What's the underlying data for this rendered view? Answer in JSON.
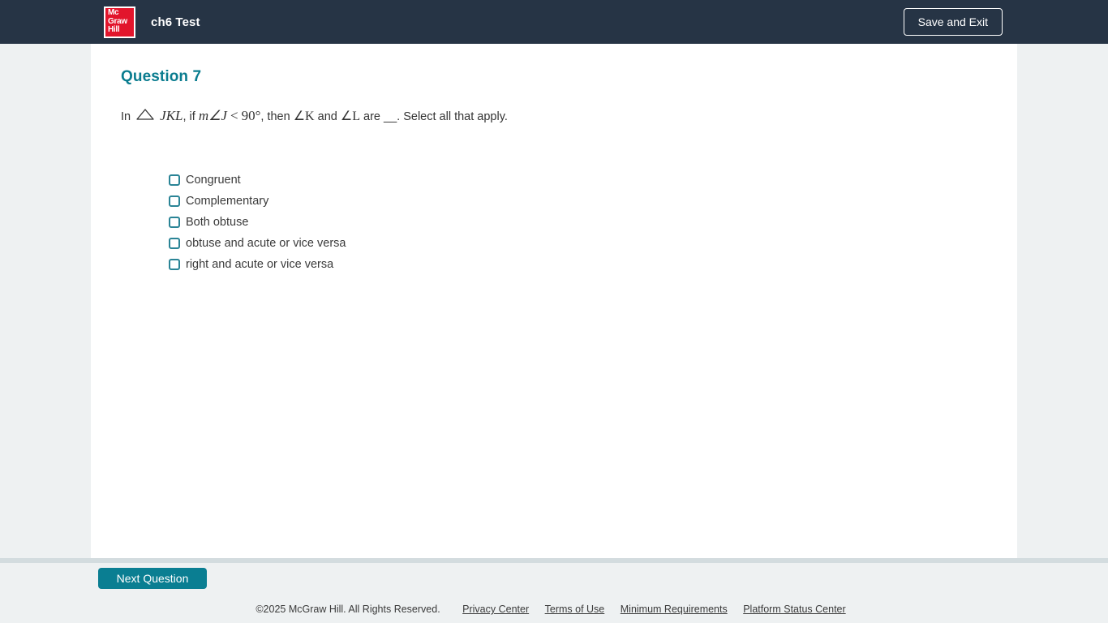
{
  "header": {
    "logo": {
      "icon": "mcgraw-hill-logo",
      "line1": "Mc",
      "line2": "Graw",
      "line3": "Hill",
      "bg_color": "#e2152c"
    },
    "title": "ch6 Test",
    "save_exit_label": "Save and Exit",
    "bg_color": "#263445"
  },
  "question": {
    "heading": "Question 7",
    "heading_color": "#0a7c8f",
    "prompt": {
      "part_in": "In",
      "triangle": "△",
      "triangle_label": "JKL",
      "part_if": ", if",
      "measure": "m∠J",
      "less_than": "<",
      "degrees": "90°",
      "part_then": ", then",
      "angle_k": "∠K",
      "part_and": "and",
      "angle_l": "∠L",
      "part_are": "are",
      "blank": "__",
      "part_select": ". Select all that apply.",
      "full_text": "In △ JKL, if m∠J < 90°, then ∠K and ∠L are __. Select all that apply."
    },
    "options": [
      {
        "label": "Congruent",
        "checked": false
      },
      {
        "label": "Complementary",
        "checked": false
      },
      {
        "label": "Both obtuse",
        "checked": false
      },
      {
        "label": "obtuse and acute or vice versa",
        "checked": false
      },
      {
        "label": "right and acute or vice versa",
        "checked": false
      }
    ],
    "checkbox_color": "#2a8496"
  },
  "footer": {
    "next_label": "Next Question",
    "next_color": "#0a7e92",
    "copyright": "©2025 McGraw Hill. All Rights Reserved.",
    "links": [
      "Privacy Center",
      "Terms of Use",
      "Minimum Requirements",
      "Platform Status Center"
    ]
  }
}
